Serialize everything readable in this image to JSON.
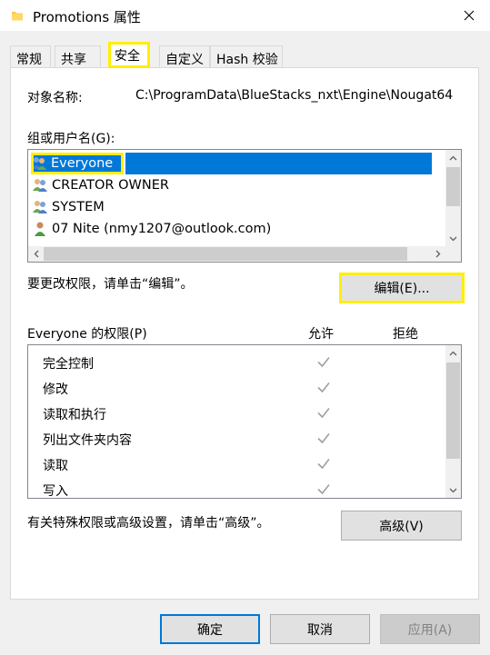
{
  "window": {
    "title": "Promotions 属性",
    "folder_icon": "folder-icon",
    "close_icon": "close-icon"
  },
  "tabs": [
    {
      "label": "常规",
      "active": false
    },
    {
      "label": "共享",
      "active": false
    },
    {
      "label": "安全",
      "active": true
    },
    {
      "label": "自定义",
      "active": false
    },
    {
      "label": "Hash 校验",
      "active": false
    }
  ],
  "security": {
    "object_name_label": "对象名称:",
    "object_name_value": "C:\\ProgramData\\BlueStacks_nxt\\Engine\\Nougat64",
    "groups_label": "组或用户名(G):",
    "users": [
      {
        "name": "Everyone",
        "icon": "user-group-icon",
        "selected": true
      },
      {
        "name": "CREATOR OWNER",
        "icon": "user-group-icon",
        "selected": false
      },
      {
        "name": "SYSTEM",
        "icon": "user-group-icon",
        "selected": false
      },
      {
        "name": "07 Nite (nmy1207@outlook.com)",
        "icon": "user-icon",
        "selected": false
      }
    ],
    "edit_hint": "要更改权限，请单击“编辑”。",
    "edit_button": "编辑(E)...",
    "permissions_label": "Everyone 的权限(P)",
    "allow_header": "允许",
    "deny_header": "拒绝",
    "permissions": [
      {
        "name": "完全控制",
        "allow": true,
        "deny": false
      },
      {
        "name": "修改",
        "allow": true,
        "deny": false
      },
      {
        "name": "读取和执行",
        "allow": true,
        "deny": false
      },
      {
        "name": "列出文件夹内容",
        "allow": true,
        "deny": false
      },
      {
        "name": "读取",
        "allow": true,
        "deny": false
      },
      {
        "name": "写入",
        "allow": true,
        "deny": false
      }
    ],
    "advanced_hint": "有关特殊权限或高级设置，请单击“高级”。",
    "advanced_button": "高级(V)"
  },
  "footer": {
    "ok_button": "确定",
    "cancel_button": "取消",
    "apply_button": "应用(A)"
  },
  "colors": {
    "selection": "#0078d7",
    "highlight": "#ffef00",
    "check_gray": "#a0a0a0"
  }
}
